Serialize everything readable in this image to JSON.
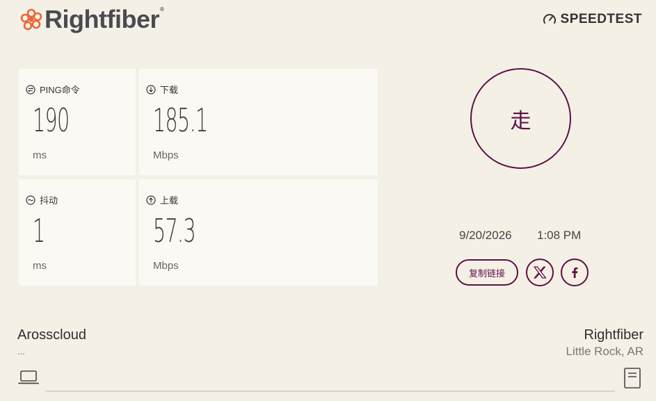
{
  "brand": {
    "name": "Rightfiber",
    "reg": "®",
    "accent": "#e8663c",
    "text_color": "#4a4a52"
  },
  "speedtest_label": "SPEEDTEST",
  "metrics": {
    "ping": {
      "label": "PING命令",
      "value": "190",
      "unit": "ms",
      "icon": "ping-icon"
    },
    "download": {
      "label": "下载",
      "value": "185.1",
      "unit": "Mbps",
      "icon": "download-arrow-icon"
    },
    "jitter": {
      "label": "抖动",
      "value": "1",
      "unit": "ms",
      "icon": "jitter-icon"
    },
    "upload": {
      "label": "上载",
      "value": "57.3",
      "unit": "Mbps",
      "icon": "upload-arrow-icon"
    }
  },
  "go_button": {
    "label": "走",
    "color": "#5c0f45"
  },
  "result": {
    "date": "9/20/2026",
    "time": "1:08 PM"
  },
  "share": {
    "copy_label": "复制链接",
    "x_icon": "x-logo-icon",
    "facebook_icon": "facebook-icon"
  },
  "client": {
    "isp": "Arosscloud",
    "ip": "...",
    "icon": "laptop-icon"
  },
  "server": {
    "name": "Rightfiber",
    "location": "Little Rock, AR",
    "icon": "server-icon"
  },
  "colors": {
    "background": "#f5f0e6",
    "card": "#fbf9f4",
    "accent": "#5c0f45"
  }
}
